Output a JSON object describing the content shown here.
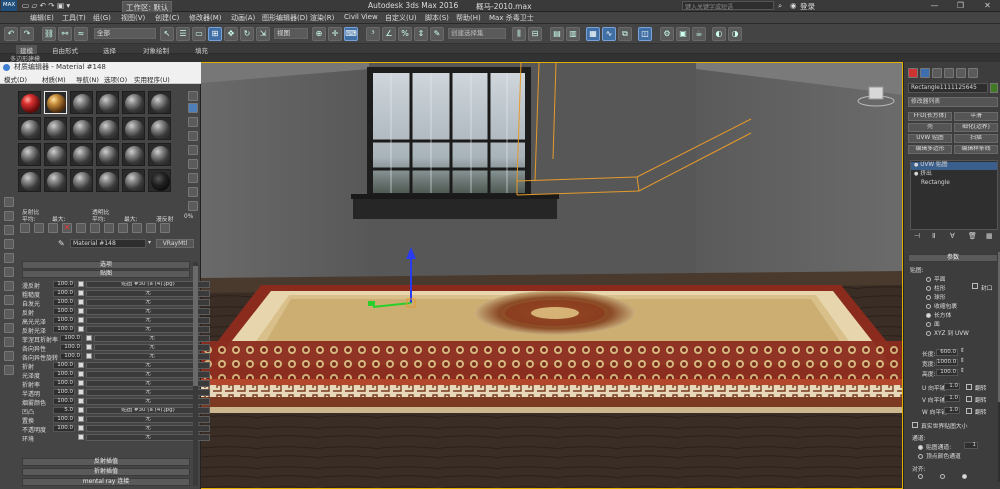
{
  "titlebar": {
    "workspace": "工作区: 默认",
    "app_title": "Autodesk 3ds Max 2016",
    "file": "概马-2010.max",
    "search_placeholder": "键入关键字或短语",
    "login": "登录"
  },
  "menu": [
    "编辑(E)",
    "工具(T)",
    "组(G)",
    "视图(V)",
    "创建(C)",
    "修改器(M)",
    "动画(A)",
    "图形编辑器(D)",
    "渲染(R)",
    "Civil View",
    "自定义(U)",
    "脚本(S)",
    "帮助(H)",
    "Max 杀毒卫士"
  ],
  "toolbar": {
    "selection_filter": "全部",
    "view_dropdown": "视图",
    "selection_set": "创建选择集"
  },
  "ribbon_tabs": [
    "建模",
    "自由形式",
    "选择",
    "对象绘制",
    "填充"
  ],
  "ribbon_sub": "多边形建模",
  "material_editor": {
    "title": "材质编辑器 - Material #148",
    "menu": [
      "模式(D)",
      "材质(M)",
      "导航(N)",
      "选项(O)",
      "实用程序(U)"
    ],
    "mini_controls": {
      "reflect": "反射比",
      "transparent": "透明比",
      "avg": "平均:",
      "max": "最大:",
      "diffuse": "漫反射",
      "pct": "0%"
    },
    "material_name": "Material #148",
    "material_type": "VRayMtl",
    "rollout_options": "选项",
    "rollout_maps": "贴图",
    "maps": [
      {
        "label": "漫反射",
        "amount": "100.0",
        "map": "贴图 #30 (a (4).jpg)"
      },
      {
        "label": "粗糙度",
        "amount": "100.0",
        "map": "无"
      },
      {
        "label": "自发光",
        "amount": "100.0",
        "map": "无"
      },
      {
        "label": "反射",
        "amount": "100.0",
        "map": "无"
      },
      {
        "label": "高光光泽",
        "amount": "100.0",
        "map": "无"
      },
      {
        "label": "反射光泽",
        "amount": "100.0",
        "map": "无"
      },
      {
        "label": "菲涅耳折射率",
        "amount": "100.0",
        "map": "无"
      },
      {
        "label": "各向异性",
        "amount": "100.0",
        "map": "无"
      },
      {
        "label": "各向异性旋转",
        "amount": "100.0",
        "map": "无"
      },
      {
        "label": "折射",
        "amount": "100.0",
        "map": "无"
      },
      {
        "label": "光泽度",
        "amount": "100.0",
        "map": "无"
      },
      {
        "label": "折射率",
        "amount": "100.0",
        "map": "无"
      },
      {
        "label": "半透明",
        "amount": "100.0",
        "map": "无"
      },
      {
        "label": "烟雾颜色",
        "amount": "100.0",
        "map": "无"
      },
      {
        "label": "凹凸",
        "amount": "5.0",
        "map": "贴图 #30 (a (4).jpg)"
      },
      {
        "label": "置换",
        "amount": "100.0",
        "map": "无"
      },
      {
        "label": "不透明度",
        "amount": "100.0",
        "map": "无"
      },
      {
        "label": "环境",
        "amount": "",
        "map": "无"
      }
    ],
    "rollout_reflect_interp": "反射插值",
    "rollout_refract_interp": "折射插值",
    "rollout_mentalray": "mental ray 连接"
  },
  "command_panel": {
    "object_name": "Rectangle1111125645",
    "modifier_list": "修改器列表",
    "buttons": [
      "FFD(长方体)",
      "平滑",
      "壳",
      "细化(边界)",
      "UVW 贴图",
      "扫描",
      "编辑多边形",
      "编辑样条线"
    ],
    "stack": [
      "UVW 贴图",
      "挤出",
      "Rectangle"
    ],
    "params_title": "参数",
    "mapping_label": "贴图:",
    "mapping_options": [
      "平面",
      "柱形",
      "球形",
      "收缩包裹",
      "长方体",
      "面",
      "XYZ 到 UVW"
    ],
    "cap_label": "封口",
    "selected_mapping": 4,
    "length_label": "长度:",
    "length": "600.0",
    "width_label": "宽度:",
    "width": "1000.0",
    "height_label": "高度:",
    "height": "100.0",
    "u_tile_label": "U 向平铺:",
    "u_tile": "1.0",
    "v_tile_label": "V 向平铺:",
    "v_tile": "1.0",
    "w_tile_label": "W 向平铺:",
    "w_tile": "1.0",
    "flip": "翻转",
    "real_world": "真实世界贴图大小",
    "channel_title": "通道:",
    "map_channel": "贴图通道:",
    "map_channel_value": "1",
    "vertex_color": "顶点颜色通道",
    "align_title": "对齐:"
  }
}
